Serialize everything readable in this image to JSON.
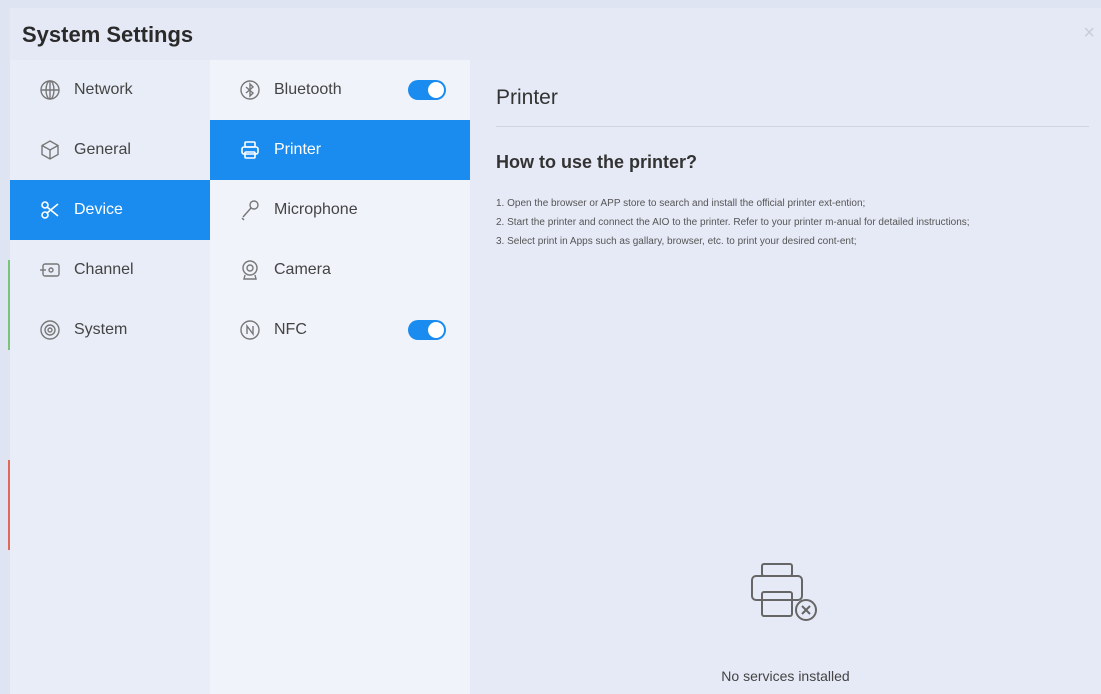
{
  "window": {
    "title": "System Settings",
    "close_glyph": "×"
  },
  "colors": {
    "accent": "#1a8cf0",
    "background": "#e5e9f5"
  },
  "nav": {
    "items": [
      {
        "label": "Network",
        "icon": "globe-icon"
      },
      {
        "label": "General",
        "icon": "cube-icon"
      },
      {
        "label": "Device",
        "icon": "device-icon",
        "active": true
      },
      {
        "label": "Channel",
        "icon": "channel-icon"
      },
      {
        "label": "System",
        "icon": "gear-icon"
      }
    ]
  },
  "device_menu": {
    "items": [
      {
        "label": "Bluetooth",
        "icon": "bluetooth-icon",
        "toggle": true,
        "toggle_on": true
      },
      {
        "label": "Printer",
        "icon": "printer-icon",
        "active": true
      },
      {
        "label": "Microphone",
        "icon": "microphone-icon"
      },
      {
        "label": "Camera",
        "icon": "camera-icon"
      },
      {
        "label": "NFC",
        "icon": "nfc-icon",
        "toggle": true,
        "toggle_on": true
      }
    ]
  },
  "panel": {
    "title": "Printer",
    "how_title": "How to use the printer?",
    "steps": [
      "1. Open the browser or APP store to search and install the official printer ext-ention;",
      "2. Start the printer and connect the AIO to the printer. Refer to your printer m-anual for detailed instructions;",
      "3. Select print in Apps such as gallary, browser, etc. to print your desired cont-ent;"
    ],
    "empty_icon": "printer-error-icon",
    "empty_text": "No services installed"
  }
}
